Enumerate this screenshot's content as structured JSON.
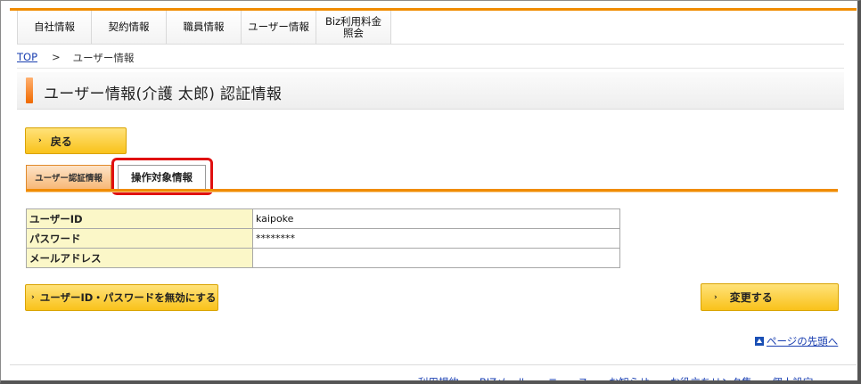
{
  "nav": {
    "items": [
      {
        "label": "自社情報"
      },
      {
        "label": "契約情報"
      },
      {
        "label": "職員情報"
      },
      {
        "label": "ユーザー情報"
      },
      {
        "label": "Biz利用料金\n照会"
      }
    ]
  },
  "breadcrumb": {
    "top": "TOP",
    "separator": ">",
    "current": "ユーザー情報"
  },
  "page": {
    "title": "ユーザー情報(介護 太郎) 認証情報"
  },
  "buttons": {
    "back": "戻る",
    "disable": "ユーザーID・パスワードを無効にする",
    "change": "変更する",
    "chevron": "›"
  },
  "tabs": {
    "auth": "ユーザー認証情報",
    "ops": "操作対象情報"
  },
  "info_table": {
    "rows": [
      {
        "label": "ユーザーID",
        "value": "kaipoke"
      },
      {
        "label": "パスワード",
        "value": "********"
      },
      {
        "label": "メールアドレス",
        "value": ""
      }
    ]
  },
  "links": {
    "page_top": "ページの先頭へ"
  },
  "footer": {
    "items": [
      "利用規約",
      "BIZメール",
      "ニュース",
      "お知らせ",
      "お役立ちリンク集",
      "個人設定"
    ],
    "arrow": "▷"
  },
  "colors": {
    "accent_orange": "#f08c00",
    "button_yellow": "#f9c21a",
    "label_bg": "#fbf7c8",
    "highlight_red": "#e01010",
    "link_blue": "#1a3fb0"
  }
}
